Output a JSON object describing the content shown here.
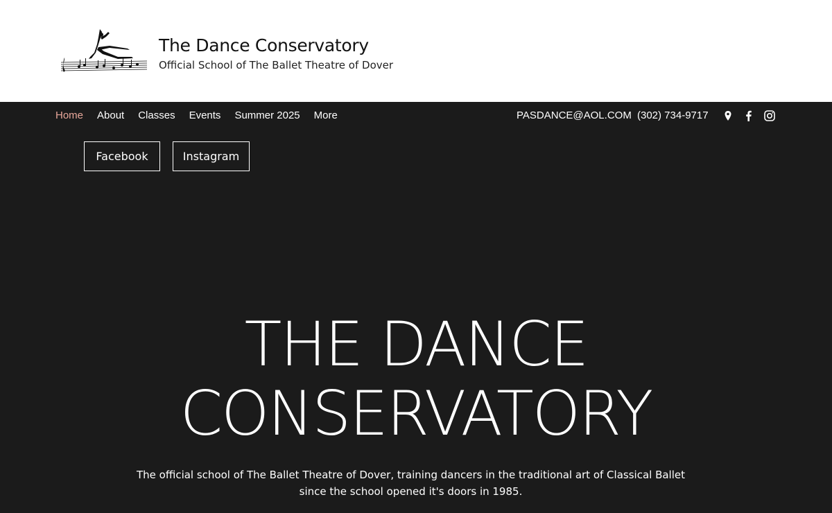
{
  "header": {
    "title": "The Dance Conservatory",
    "subtitle": "Official School of The Ballet Theatre of Dover"
  },
  "nav": {
    "items": [
      {
        "label": "Home",
        "active": true
      },
      {
        "label": "About"
      },
      {
        "label": "Classes"
      },
      {
        "label": "Events"
      },
      {
        "label": "Summer 2025"
      },
      {
        "label": "More"
      }
    ],
    "email": "PASDANCE@AOL.COM",
    "phone": "(302) 734-9717",
    "social_icons": [
      "map-pin-icon",
      "facebook-icon",
      "instagram-icon"
    ]
  },
  "buttons": {
    "facebook": "Facebook",
    "instagram": "Instagram"
  },
  "hero": {
    "title_line1": "THE DANCE",
    "title_line2": "CONSERVATORY",
    "description": "The official school of The Ballet Theatre of Dover, training dancers in the traditional art of Classical Ballet since the school opened it's doors in 1985."
  },
  "colors": {
    "background": "#1b1b1b",
    "header_bg": "#ffffff",
    "active_nav": "#e8a79a",
    "text": "#ffffff"
  }
}
